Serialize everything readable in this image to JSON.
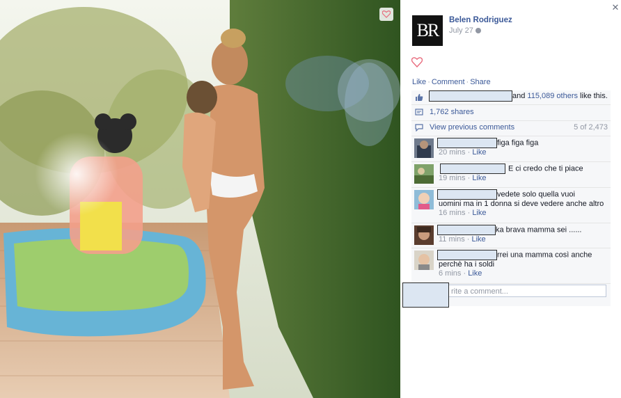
{
  "post": {
    "author": "Belen Rodriguez",
    "avatar_text": "BR",
    "date": "July 27",
    "actions": {
      "like": "Like",
      "comment": "Comment",
      "share": "Share"
    },
    "likes_text_suffix": "and ",
    "likes_count": "115,089 others",
    "likes_end": " like this.",
    "shares": "1,762 shares",
    "view_previous": "View previous comments",
    "comment_count": "5 of 2,473",
    "write_placeholder": "rite a comment..."
  },
  "comments": [
    {
      "text_line1": "figa figa figa",
      "text_line2": "",
      "time": "20 mins",
      "like": "Like"
    },
    {
      "text_line1": "E ci credo che ti piace",
      "text_line2": "",
      "time": "19 mins",
      "like": "Like"
    },
    {
      "text_line1": "vedete solo quella vuoi",
      "text_line2": "uomini ma in 1 donna si deve vedere anche altro",
      "time": "16 mins",
      "like": "Like"
    },
    {
      "text_line1": "ka brava mamma sei ......",
      "text_line2": "",
      "time": "11 mins",
      "like": "Like"
    },
    {
      "text_line1": "rrei una mamma così anche",
      "text_line2": "perchè ha i soldi",
      "time": "6 mins",
      "like": "Like"
    }
  ],
  "colors": {
    "link": "#3b5998",
    "meta": "#9197a3",
    "ufi_bg": "#f6f7f9",
    "heart": "#e86a7c"
  },
  "icons": [
    "heart-icon",
    "close-icon",
    "globe-icon",
    "thumbs-up-icon",
    "share-icon",
    "comment-icon"
  ]
}
